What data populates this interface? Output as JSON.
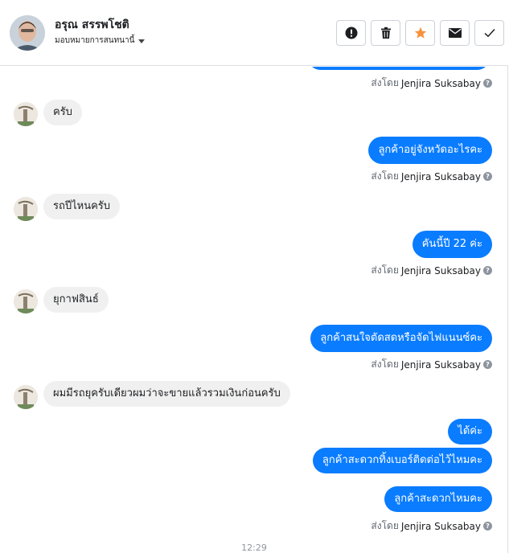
{
  "header": {
    "customer_name": "อรุณ สรรพโชติ",
    "assign_label": "มอบหมายการสนทนานี้",
    "actions": [
      "report-icon",
      "trash-icon",
      "star-icon",
      "mail-icon",
      "check-icon"
    ],
    "star_color": "#f7923b"
  },
  "thread": {
    "sender_prefix": "ส่งโดย",
    "sender_name": "Jenjira Suksabay",
    "messages": [
      {
        "dir": "in",
        "text": "ครับ"
      },
      {
        "dir": "out",
        "text": "ลูกค้าอยู่จังหวัดอะไรคะ"
      },
      {
        "dir": "in",
        "text": "รถปีไหนครับ"
      },
      {
        "dir": "out",
        "text": "คันนี้ปี 22 ค่ะ"
      },
      {
        "dir": "in",
        "text": "ยุกาฟสินธ์"
      },
      {
        "dir": "out",
        "text": "ลูกค้าสนใจตัดสดหรือจัดไฟแนนซ์คะ"
      },
      {
        "dir": "in",
        "text": "ผมมีรถยุครับเดียวผมว่าจะขายแล้วรวมเงินก่อนครับ"
      },
      {
        "dir": "out",
        "text": "ได้ค่ะ"
      },
      {
        "dir": "out",
        "text": "ลูกค้าสะดวกทิ้งเบอร์ติดต่อไว้ไหมคะ"
      },
      {
        "dir": "out",
        "text": "ลูกค้าสะดวกไหมคะ"
      }
    ],
    "timestamp": "12:29"
  },
  "colors": {
    "outgoing": "#0a7cff",
    "incoming": "#f0f0f0"
  }
}
